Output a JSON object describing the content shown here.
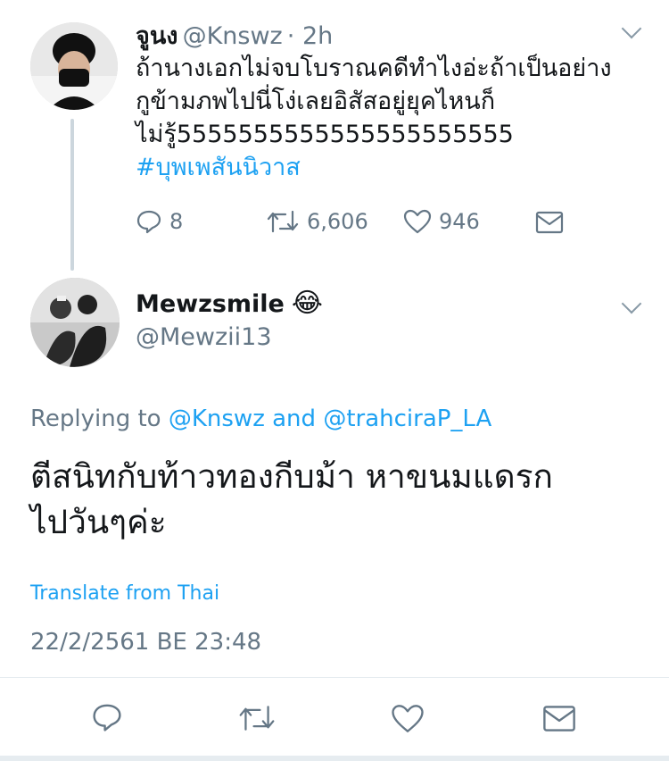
{
  "parent_tweet": {
    "display_name": "จูนง",
    "handle": "@Knswz",
    "time": "· 2h",
    "lines": [
      "ถ้านางเอกไม่จบโบราณคดีทำไงอ่ะถ้าเป็นอย่าง",
      "กูข้ามภพไปนี่โง่เลยอิสัสอยู่ยุคไหนก็",
      "ไม่รู้5555555555555555555555"
    ],
    "hashtag": "#บุพเพสันนิวาส",
    "actions": {
      "reply_count": "8",
      "retweet_count": "6,606",
      "like_count": "946"
    }
  },
  "reply_tweet": {
    "display_name": "Mewzsmile",
    "emoji": "😂",
    "handle": "@Mewzii13",
    "replying_to": {
      "prefix": "Replying to",
      "mention1": "@Knswz",
      "joiner": "and",
      "mention2": "@trahciraP_LA"
    },
    "lines": [
      "ตีสนิทกับท้าวทองกีบม้า หาขนมแดรก",
      "ไปวันๆค่ะ"
    ],
    "translate_label": "Translate from Thai",
    "timestamp": "22/2/2561 BE 23:48"
  },
  "colors": {
    "accent": "#1da1f2",
    "muted": "#657786",
    "text": "#14171a",
    "thread_line": "#ccd6dd"
  }
}
